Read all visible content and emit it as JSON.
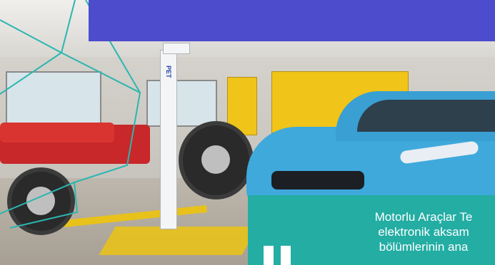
{
  "scene": {
    "description_icon": "workshop-photo",
    "lift_label": "PET"
  },
  "quote": {
    "lines": [
      "Motorlu Araçlar Te",
      "elektronik aksam",
      "bölümlerinin ana"
    ]
  },
  "colors": {
    "banner": "#4d4ccc",
    "quote_card": "#23ada3",
    "polygon_stroke": "#2bb6b0"
  }
}
